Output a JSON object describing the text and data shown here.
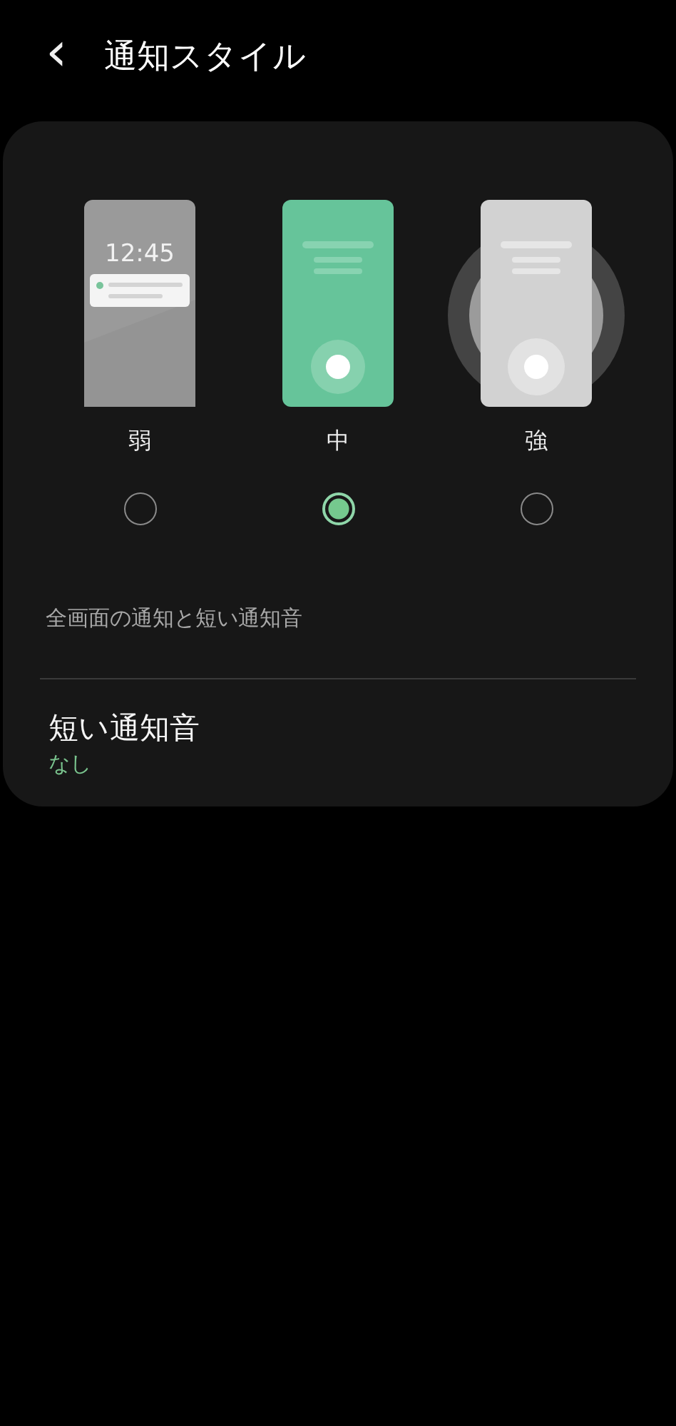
{
  "header": {
    "back": "‹",
    "title": "通知スタイル"
  },
  "styles": [
    {
      "kind": "brief",
      "label": "弱",
      "clock": "12:45",
      "selected": false
    },
    {
      "kind": "medium",
      "label": "中",
      "selected": true
    },
    {
      "kind": "strong",
      "label": "強",
      "selected": false
    }
  ],
  "description": "全画面の通知と短い通知音",
  "setting": {
    "title": "短い通知音",
    "value": "なし"
  }
}
